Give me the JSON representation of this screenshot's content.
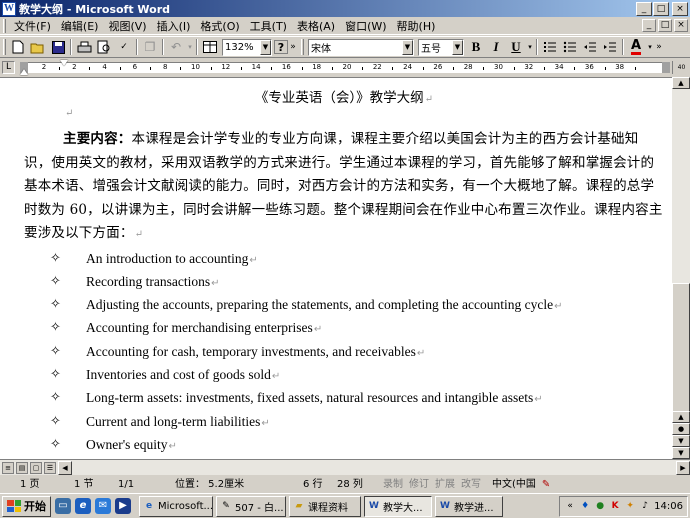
{
  "window": {
    "title": "教学大纲 - Microsoft Word",
    "controls": [
      "_",
      "□",
      "×"
    ]
  },
  "menubar": {
    "items": [
      "文件(F)",
      "编辑(E)",
      "视图(V)",
      "插入(I)",
      "格式(O)",
      "工具(T)",
      "表格(A)",
      "窗口(W)",
      "帮助(H)"
    ],
    "doc_controls": [
      "_",
      "□",
      "×"
    ]
  },
  "toolbar": {
    "zoom": "132%",
    "font": "宋体",
    "size": "五号",
    "bold": "B",
    "italic": "I",
    "underline": "U",
    "font_color": "A"
  },
  "ruler": {
    "tab_selector": "L",
    "numbers": [
      "2",
      "2",
      "4",
      "6",
      "8",
      "10",
      "12",
      "14",
      "16",
      "18",
      "20",
      "22",
      "24",
      "26",
      "28",
      "30",
      "32",
      "34",
      "36",
      "38"
    ],
    "end_label": "40"
  },
  "document": {
    "title": "《专业英语（会）》教学大纲",
    "para_lead": "主要内容：",
    "para_text": "本课程是会计学专业的专业方向课，课程主要介绍以美国会计为主的西方会计基础知识，使用英文的教材，采用双语教学的方式来进行。学生通过本课程的学习，首先能够了解和掌握会计的基本术语、增强会计文献阅读的能力。同时，对西方会计的方法和实务，有一个大概地了解。课程的总学时数为 60，以讲课为主，同时会讲解一些练习题。整个课程期间会在作业中心布置三次作业。课程内容主要涉及以下方面：",
    "bullet_symbol": "✧",
    "bullets": [
      "An introduction to accounting",
      "Recording transactions",
      "Adjusting the accounts, preparing the statements, and completing the accounting cycle",
      "Accounting for merchandising enterprises",
      "Accounting for cash, temporary investments, and receivables",
      "Inventories and cost of goods sold",
      "Long-term assets: investments, fixed assets, natural resources and intangible assets",
      "Current and long-term liabilities",
      "Owner's equity"
    ]
  },
  "statusbar": {
    "page": "1 页",
    "section": "1 节",
    "page_of": "1/1",
    "position": "位置： 5.2厘米",
    "line": "6 行",
    "column": "28 列",
    "rec": "录制",
    "trk": "修订",
    "ext": "扩展",
    "ovr": "改写",
    "language": "中文(中国"
  },
  "taskbar": {
    "start": "开始",
    "tasks": [
      "Microsoft...",
      "507 - 白...",
      "课程资料",
      "教学大...",
      "教学进..."
    ],
    "active_task": 3,
    "clock": "14:06"
  },
  "colors": {
    "titlebar_start": "#0a246a",
    "titlebar_end": "#a6caf0",
    "chrome": "#d4d0c8",
    "font_color_bar": "#e00000"
  }
}
